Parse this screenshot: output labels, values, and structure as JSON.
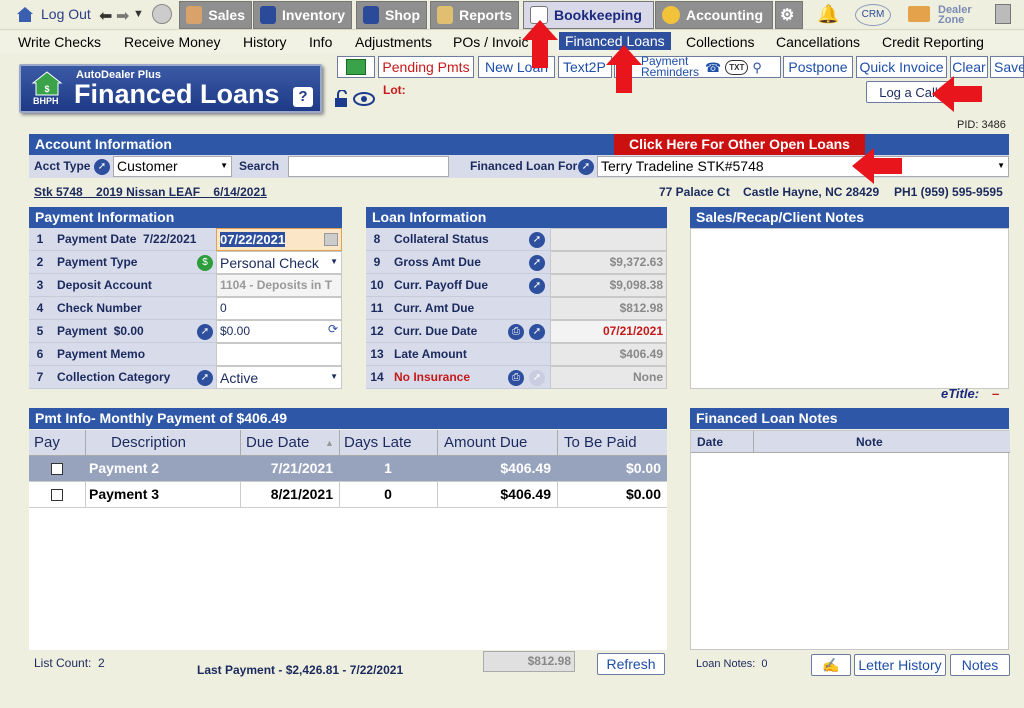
{
  "nav": {
    "logout": "Log Out",
    "sales": "Sales",
    "inventory": "Inventory",
    "shop": "Shop",
    "reports": "Reports",
    "bookkeeping": "Bookkeeping",
    "accounting": "Accounting",
    "crm": "CRM",
    "dealer_zone_1": "Dealer",
    "dealer_zone_2": "Zone"
  },
  "subnav": [
    "Write Checks",
    "Receive Money",
    "History",
    "Info",
    "Adjustments",
    "POs / Invoices",
    "Financed Loans",
    "Collections",
    "Cancellations",
    "Credit Reporting"
  ],
  "logo": {
    "brand": "AutoDealer Plus",
    "badge": "BHPH",
    "title": "Financed Loans",
    "help": "?"
  },
  "actions": {
    "pending": "Pending Pmts",
    "new_loan": "New Loan",
    "text2pay": "Text2P",
    "pay_rem_1": "Payment",
    "pay_rem_2": "Reminders",
    "txt": "TXT",
    "postpone": "Postpone",
    "quick_invoice": "Quick Invoice",
    "clear": "Clear",
    "save": "Save",
    "log_call": "Log a Call",
    "lot_label": "Lot:"
  },
  "pid": "PID: 3486",
  "account": {
    "header": "Account Information",
    "other_loans": "Click Here For Other Open Loans",
    "acct_type_label": "Acct Type",
    "acct_type_value": "Customer",
    "search_label": "Search",
    "financed_for_label": "Financed Loan For",
    "financed_for_value": "Terry Tradeline STK#5748",
    "stock_line": "Stk 5748    2019 Nissan LEAF    6/14/2021",
    "address": "77 Palace Ct    Castle Hayne, NC 28429",
    "phone": "PH1 (959) 595-9595"
  },
  "payment_info": {
    "header": "Payment Information",
    "rows": [
      {
        "n": "1",
        "label": "Payment Date  7/22/2021",
        "value": "07/22/2021"
      },
      {
        "n": "2",
        "label": "Payment Type",
        "value": "Personal Check"
      },
      {
        "n": "3",
        "label": "Deposit Account",
        "value": "1104 - Deposits in T"
      },
      {
        "n": "4",
        "label": "Check Number",
        "value": "0"
      },
      {
        "n": "5",
        "label": "Payment  $0.00",
        "value": "$0.00"
      },
      {
        "n": "6",
        "label": "Payment Memo",
        "value": ""
      },
      {
        "n": "7",
        "label": "Collection Category",
        "value": "Active"
      }
    ]
  },
  "loan_info": {
    "header": "Loan Information",
    "rows": [
      {
        "n": "8",
        "label": "Collateral Status",
        "value": ""
      },
      {
        "n": "9",
        "label": "Gross Amt Due",
        "value": "$9,372.63"
      },
      {
        "n": "10",
        "label": "Curr. Payoff Due",
        "value": "$9,098.38"
      },
      {
        "n": "11",
        "label": "Curr. Amt Due",
        "value": "$812.98"
      },
      {
        "n": "12",
        "label": "Curr. Due Date",
        "value": "07/21/2021"
      },
      {
        "n": "13",
        "label": "Late Amount",
        "value": "$406.49"
      },
      {
        "n": "14",
        "label": "No Insurance",
        "value": "None"
      }
    ]
  },
  "notes": {
    "header": "Sales/Recap/Client Notes"
  },
  "etitle": {
    "label": "eTitle:",
    "value": "–"
  },
  "pmt_table": {
    "header": "Pmt Info- Monthly Payment of $406.49",
    "columns": [
      "Pay",
      "Description",
      "Due Date",
      "Days Late",
      "Amount Due",
      "To Be Paid"
    ],
    "rows": [
      {
        "desc": "Payment 2",
        "due": "7/21/2021",
        "days": "1",
        "amount": "$406.49",
        "paid": "$0.00"
      },
      {
        "desc": "Payment 3",
        "due": "8/21/2021",
        "days": "0",
        "amount": "$406.49",
        "paid": "$0.00"
      }
    ],
    "list_count": "List Count:  2",
    "last_payment": "Last Payment - $2,426.81 - 7/22/2021",
    "total": "$812.98",
    "refresh": "Refresh"
  },
  "loan_notes": {
    "header": "Financed Loan Notes",
    "columns": [
      "Date",
      "Note"
    ],
    "count": "Loan Notes:  0",
    "letter_history": "Letter History",
    "notes_btn": "Notes"
  },
  "colors": {
    "accent": "#2f57a7",
    "highlight": "#e8161c",
    "nav_active": "#2d4f9e"
  }
}
